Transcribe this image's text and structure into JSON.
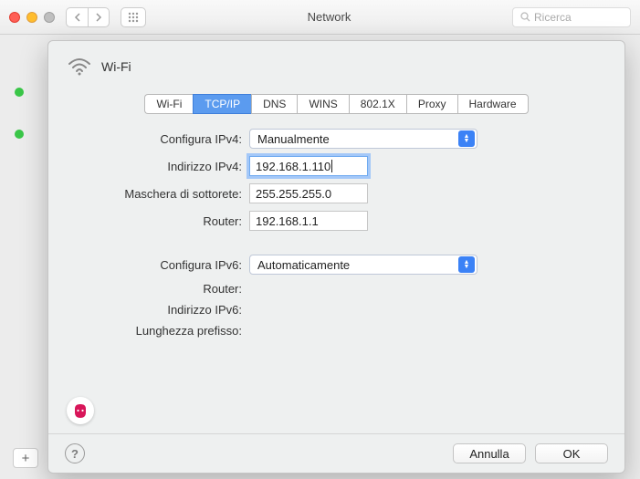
{
  "window": {
    "title": "Network",
    "search_placeholder": "Ricerca"
  },
  "sheet": {
    "title": "Wi-Fi"
  },
  "tabs": [
    "Wi-Fi",
    "TCP/IP",
    "DNS",
    "WINS",
    "802.1X",
    "Proxy",
    "Hardware"
  ],
  "active_tab_index": 1,
  "fields": {
    "configure_ipv4_label": "Configura IPv4:",
    "configure_ipv4_value": "Manualmente",
    "ipv4_address_label": "Indirizzo IPv4:",
    "ipv4_address_value": "192.168.1.110",
    "subnet_label": "Maschera di sottorete:",
    "subnet_value": "255.255.255.0",
    "router_label": "Router:",
    "router_value": "192.168.1.1",
    "configure_ipv6_label": "Configura IPv6:",
    "configure_ipv6_value": "Automaticamente",
    "router6_label": "Router:",
    "ipv6_address_label": "Indirizzo IPv6:",
    "prefix_label": "Lunghezza prefisso:"
  },
  "footer": {
    "cancel": "Annulla",
    "ok": "OK"
  }
}
